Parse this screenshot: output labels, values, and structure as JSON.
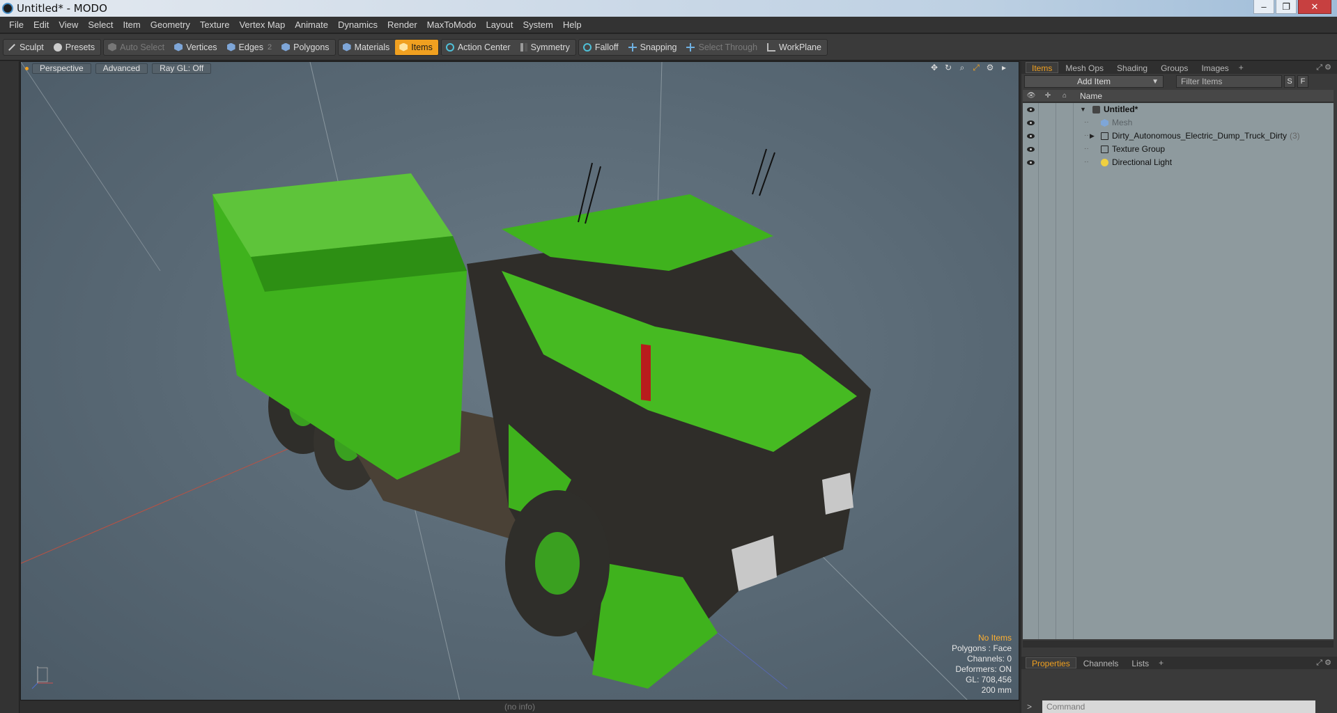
{
  "window": {
    "title": "Untitled* - MODO",
    "buttons": {
      "minimize": "–",
      "maximize": "❐",
      "close": "✕"
    }
  },
  "menubar": {
    "items": [
      "File",
      "Edit",
      "View",
      "Select",
      "Item",
      "Geometry",
      "Texture",
      "Vertex Map",
      "Animate",
      "Dynamics",
      "Render",
      "MaxToModo",
      "Layout",
      "System",
      "Help"
    ]
  },
  "toolbar": {
    "sculpt": "Sculpt",
    "presets": "Presets",
    "auto_select": "Auto Select",
    "vertices": "Vertices",
    "edges": "Edges",
    "edges_count": "2",
    "polygons": "Polygons",
    "materials": "Materials",
    "items": "Items",
    "action_center": "Action Center",
    "symmetry": "Symmetry",
    "falloff": "Falloff",
    "snapping": "Snapping",
    "select_through": "Select Through",
    "workplane": "WorkPlane"
  },
  "viewport": {
    "view_mode": "Perspective",
    "shading": "Advanced",
    "raygl": "Ray GL: Off",
    "info": {
      "selection": "No Items",
      "polygons": "Polygons : Face",
      "channels": "Channels: 0",
      "deformers": "Deformers: ON",
      "gl": "GL: 708,456",
      "scale": "200 mm"
    },
    "status": "(no info)"
  },
  "items_panel": {
    "tabs": [
      "Items",
      "Mesh Ops",
      "Shading",
      "Groups",
      "Images"
    ],
    "active_tab": "Items",
    "add_item": "Add Item",
    "filter_placeholder": "Filter Items",
    "s_button": "S",
    "f_button": "F",
    "column_name": "Name",
    "tree": [
      {
        "label": "Untitled*",
        "icon": "scene-icon",
        "bold": true,
        "expanded": true
      },
      {
        "label": "Mesh",
        "icon": "mesh-icon",
        "dim": true
      },
      {
        "label": "Dirty_Autonomous_Electric_Dump_Truck_Dirty",
        "count": "(3)",
        "icon": "group-icon",
        "collapsed": true
      },
      {
        "label": "Texture Group",
        "icon": "group-icon"
      },
      {
        "label": "Directional Light",
        "icon": "light-icon"
      }
    ]
  },
  "properties_panel": {
    "tabs": [
      "Properties",
      "Channels",
      "Lists"
    ],
    "active_tab": "Properties",
    "command_placeholder": "Command"
  },
  "colors": {
    "accent": "#f0a020",
    "truck_green": "#3fb21d",
    "viewport_bg": "#5b6b76"
  }
}
